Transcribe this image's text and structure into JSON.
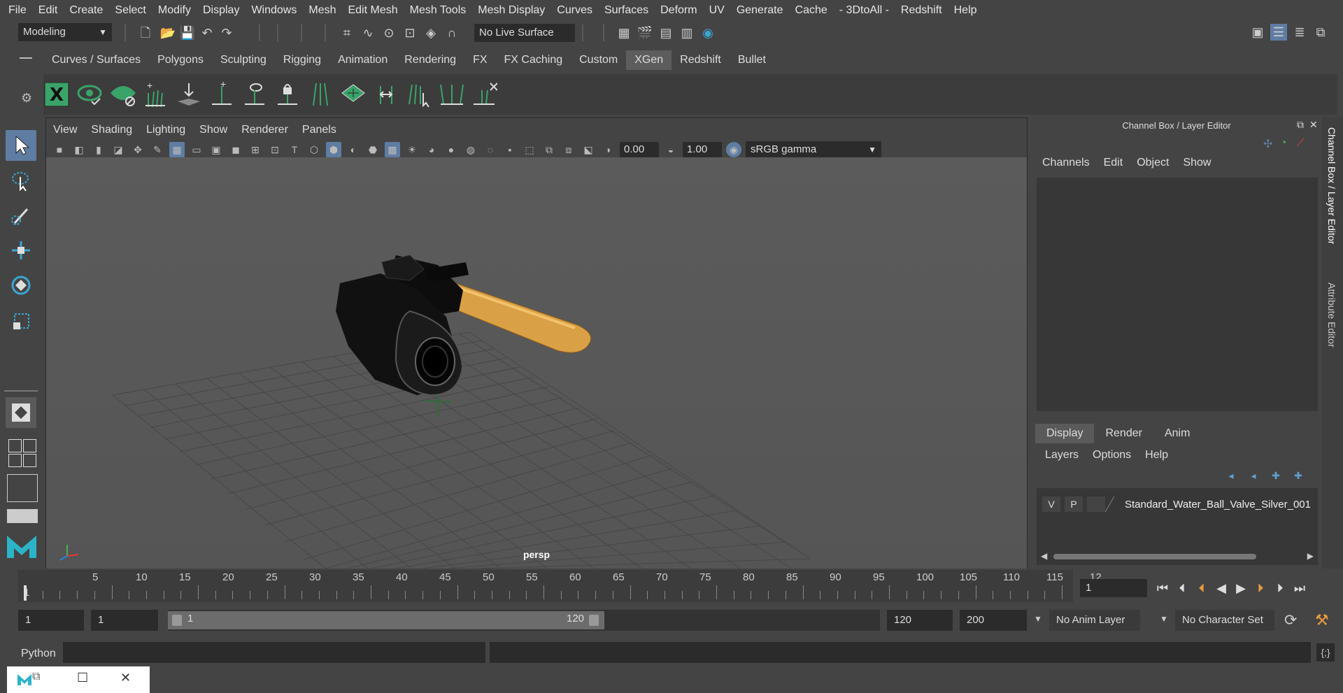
{
  "menubar": {
    "items": [
      "File",
      "Edit",
      "Create",
      "Select",
      "Modify",
      "Display",
      "Windows",
      "Mesh",
      "Edit Mesh",
      "Mesh Tools",
      "Mesh Display",
      "Curves",
      "Surfaces",
      "Deform",
      "UV",
      "Generate",
      "Cache",
      "- 3DtoAll -",
      "Redshift",
      "Help"
    ]
  },
  "statusline": {
    "mode": "Modeling",
    "live_surface": "No Live Surface"
  },
  "shelf": {
    "tabs": [
      "Curves / Surfaces",
      "Polygons",
      "Sculpting",
      "Rigging",
      "Animation",
      "Rendering",
      "FX",
      "FX Caching",
      "Custom",
      "XGen",
      "Redshift",
      "Bullet"
    ],
    "active_tab": "XGen"
  },
  "viewport": {
    "menu": [
      "View",
      "Shading",
      "Lighting",
      "Show",
      "Renderer",
      "Panels"
    ],
    "exposure": "0.00",
    "gamma": "1.00",
    "color_space": "sRGB gamma",
    "camera_label": "persp"
  },
  "channelbox": {
    "title": "Channel Box / Layer Editor",
    "menu": [
      "Channels",
      "Edit",
      "Object",
      "Show"
    ],
    "layer_tabs": [
      "Display",
      "Render",
      "Anim"
    ],
    "layer_menu": [
      "Layers",
      "Options",
      "Help"
    ],
    "layer": {
      "v": "V",
      "p": "P",
      "name": "Standard_Water_Ball_Valve_Silver_001"
    },
    "side_tabs": [
      "Channel Box / Layer Editor",
      "Attribute Editor"
    ]
  },
  "timeslider": {
    "ticks": [
      "1",
      "5",
      "10",
      "15",
      "20",
      "25",
      "30",
      "35",
      "40",
      "45",
      "50",
      "55",
      "60",
      "65",
      "70",
      "75",
      "80",
      "85",
      "90",
      "95",
      "100",
      "105",
      "110",
      "115",
      "12"
    ],
    "current_frame": "1"
  },
  "range": {
    "start": "1",
    "anim_start": "1",
    "range_start": "1",
    "range_end": "120",
    "anim_end": "120",
    "end": "200",
    "anim_layer": "No Anim Layer",
    "character_set": "No Character Set"
  },
  "cmdline": {
    "label": "Python"
  },
  "colors": {
    "accent": "#5f7da3",
    "shelf_green": "#3aa36a",
    "handle": "#d9a045"
  }
}
